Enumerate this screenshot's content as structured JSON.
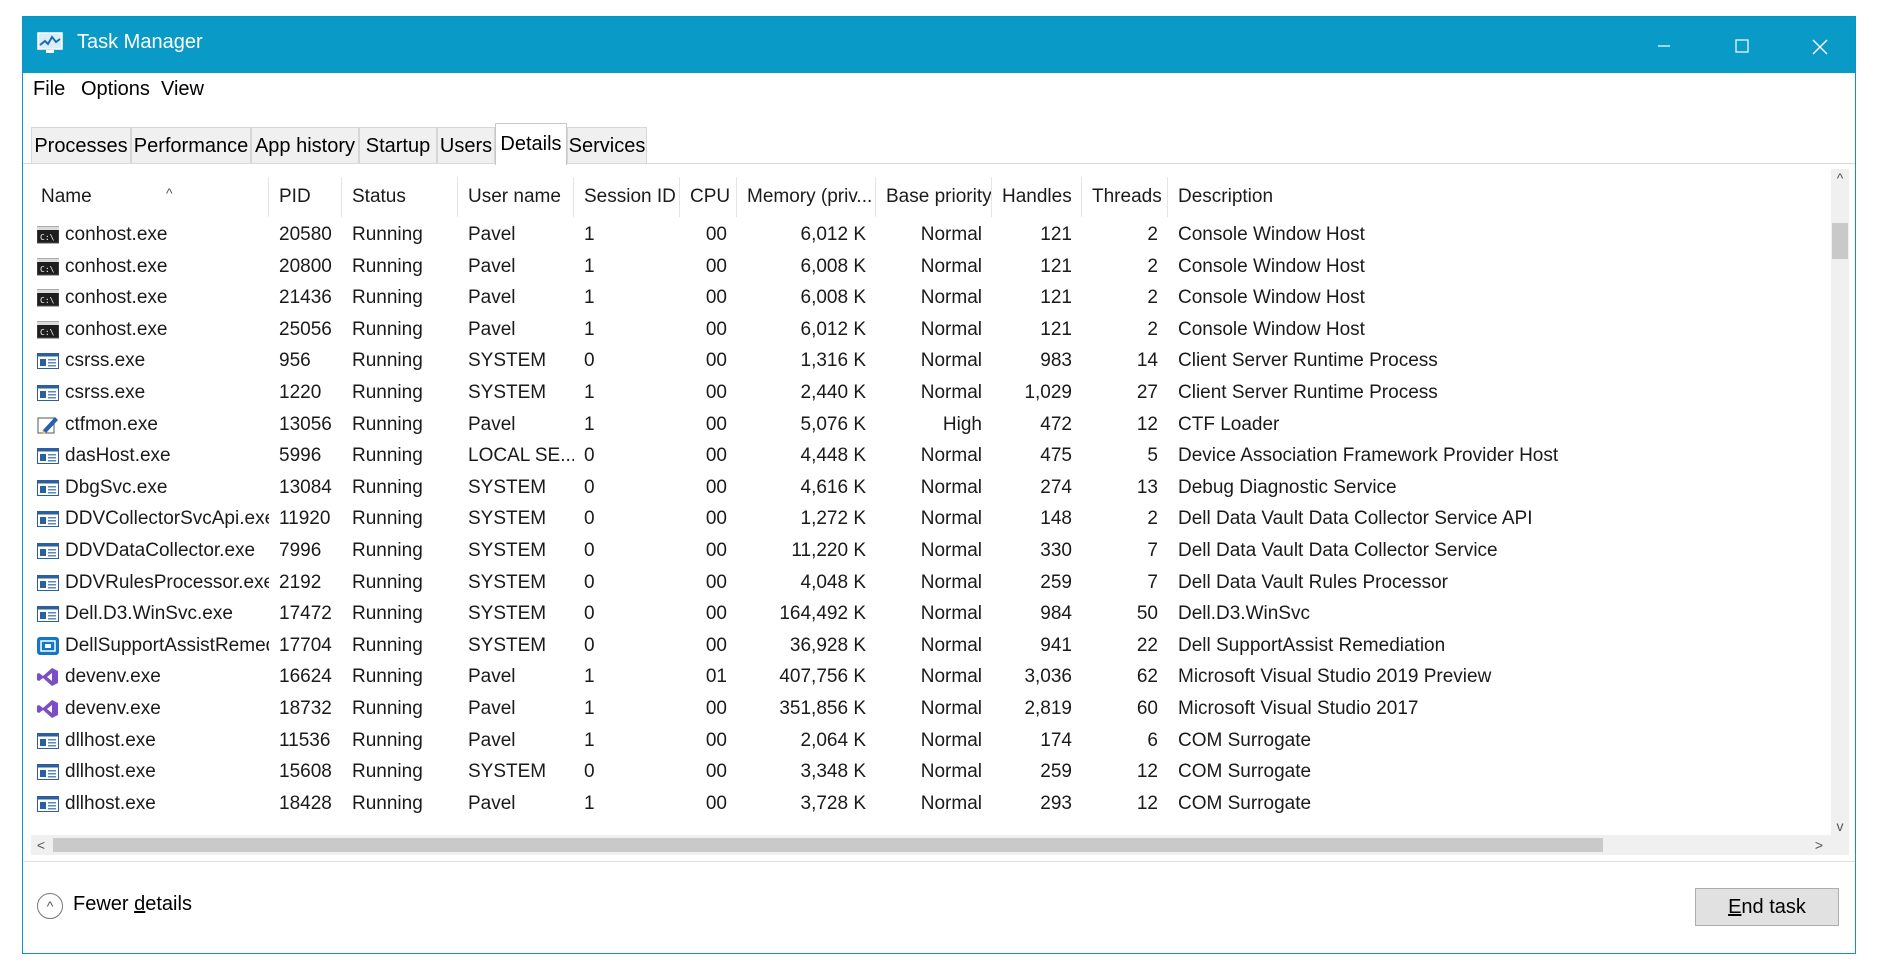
{
  "window": {
    "title": "Task Manager"
  },
  "menu": [
    "File",
    "Options",
    "View"
  ],
  "tabs": [
    "Processes",
    "Performance",
    "App history",
    "Startup",
    "Users",
    "Details",
    "Services"
  ],
  "active_tab": "Details",
  "columns": [
    "Name",
    "PID",
    "Status",
    "User name",
    "Session ID",
    "CPU",
    "Memory (priv...",
    "Base priority",
    "Handles",
    "Threads",
    "Description"
  ],
  "sort_column": "Name",
  "rows": [
    {
      "name": "conhost.exe",
      "icon": "console-icon",
      "pid": "20580",
      "status": "Running",
      "user": "Pavel",
      "session": "1",
      "cpu": "00",
      "memory": "6,012 K",
      "priority": "Normal",
      "handles": "121",
      "threads": "2",
      "description": "Console Window Host"
    },
    {
      "name": "conhost.exe",
      "icon": "console-icon",
      "pid": "20800",
      "status": "Running",
      "user": "Pavel",
      "session": "1",
      "cpu": "00",
      "memory": "6,008 K",
      "priority": "Normal",
      "handles": "121",
      "threads": "2",
      "description": "Console Window Host"
    },
    {
      "name": "conhost.exe",
      "icon": "console-icon",
      "pid": "21436",
      "status": "Running",
      "user": "Pavel",
      "session": "1",
      "cpu": "00",
      "memory": "6,008 K",
      "priority": "Normal",
      "handles": "121",
      "threads": "2",
      "description": "Console Window Host"
    },
    {
      "name": "conhost.exe",
      "icon": "console-icon",
      "pid": "25056",
      "status": "Running",
      "user": "Pavel",
      "session": "1",
      "cpu": "00",
      "memory": "6,012 K",
      "priority": "Normal",
      "handles": "121",
      "threads": "2",
      "description": "Console Window Host"
    },
    {
      "name": "csrss.exe",
      "icon": "app-window-icon",
      "pid": "956",
      "status": "Running",
      "user": "SYSTEM",
      "session": "0",
      "cpu": "00",
      "memory": "1,316 K",
      "priority": "Normal",
      "handles": "983",
      "threads": "14",
      "description": "Client Server Runtime Process"
    },
    {
      "name": "csrss.exe",
      "icon": "app-window-icon",
      "pid": "1220",
      "status": "Running",
      "user": "SYSTEM",
      "session": "1",
      "cpu": "00",
      "memory": "2,440 K",
      "priority": "Normal",
      "handles": "1,029",
      "threads": "27",
      "description": "Client Server Runtime Process"
    },
    {
      "name": "ctfmon.exe",
      "icon": "pen-icon",
      "pid": "13056",
      "status": "Running",
      "user": "Pavel",
      "session": "1",
      "cpu": "00",
      "memory": "5,076 K",
      "priority": "High",
      "handles": "472",
      "threads": "12",
      "description": "CTF Loader"
    },
    {
      "name": "dasHost.exe",
      "icon": "app-window-icon",
      "pid": "5996",
      "status": "Running",
      "user": "LOCAL SE...",
      "session": "0",
      "cpu": "00",
      "memory": "4,448 K",
      "priority": "Normal",
      "handles": "475",
      "threads": "5",
      "description": "Device Association Framework Provider Host"
    },
    {
      "name": "DbgSvc.exe",
      "icon": "app-window-icon",
      "pid": "13084",
      "status": "Running",
      "user": "SYSTEM",
      "session": "0",
      "cpu": "00",
      "memory": "4,616 K",
      "priority": "Normal",
      "handles": "274",
      "threads": "13",
      "description": "Debug Diagnostic Service"
    },
    {
      "name": "DDVCollectorSvcApi.exe",
      "icon": "app-window-icon",
      "pid": "11920",
      "status": "Running",
      "user": "SYSTEM",
      "session": "0",
      "cpu": "00",
      "memory": "1,272 K",
      "priority": "Normal",
      "handles": "148",
      "threads": "2",
      "description": "Dell Data Vault Data Collector Service API"
    },
    {
      "name": "DDVDataCollector.exe",
      "icon": "app-window-icon",
      "pid": "7996",
      "status": "Running",
      "user": "SYSTEM",
      "session": "0",
      "cpu": "00",
      "memory": "11,220 K",
      "priority": "Normal",
      "handles": "330",
      "threads": "7",
      "description": "Dell Data Vault Data Collector Service"
    },
    {
      "name": "DDVRulesProcessor.exe",
      "icon": "app-window-icon",
      "pid": "2192",
      "status": "Running",
      "user": "SYSTEM",
      "session": "0",
      "cpu": "00",
      "memory": "4,048 K",
      "priority": "Normal",
      "handles": "259",
      "threads": "7",
      "description": "Dell Data Vault Rules Processor"
    },
    {
      "name": "Dell.D3.WinSvc.exe",
      "icon": "app-window-icon",
      "pid": "17472",
      "status": "Running",
      "user": "SYSTEM",
      "session": "0",
      "cpu": "00",
      "memory": "164,492 K",
      "priority": "Normal",
      "handles": "984",
      "threads": "50",
      "description": "Dell.D3.WinSvc"
    },
    {
      "name": "DellSupportAssistRemed...",
      "icon": "dell-support-icon",
      "pid": "17704",
      "status": "Running",
      "user": "SYSTEM",
      "session": "0",
      "cpu": "00",
      "memory": "36,928 K",
      "priority": "Normal",
      "handles": "941",
      "threads": "22",
      "description": "Dell SupportAssist Remediation"
    },
    {
      "name": "devenv.exe",
      "icon": "visual-studio-icon",
      "pid": "16624",
      "status": "Running",
      "user": "Pavel",
      "session": "1",
      "cpu": "01",
      "memory": "407,756 K",
      "priority": "Normal",
      "handles": "3,036",
      "threads": "62",
      "description": "Microsoft Visual Studio 2019 Preview"
    },
    {
      "name": "devenv.exe",
      "icon": "visual-studio-icon",
      "pid": "18732",
      "status": "Running",
      "user": "Pavel",
      "session": "1",
      "cpu": "00",
      "memory": "351,856 K",
      "priority": "Normal",
      "handles": "2,819",
      "threads": "60",
      "description": "Microsoft Visual Studio 2017"
    },
    {
      "name": "dllhost.exe",
      "icon": "app-window-icon",
      "pid": "11536",
      "status": "Running",
      "user": "Pavel",
      "session": "1",
      "cpu": "00",
      "memory": "2,064 K",
      "priority": "Normal",
      "handles": "174",
      "threads": "6",
      "description": "COM Surrogate"
    },
    {
      "name": "dllhost.exe",
      "icon": "app-window-icon",
      "pid": "15608",
      "status": "Running",
      "user": "SYSTEM",
      "session": "0",
      "cpu": "00",
      "memory": "3,348 K",
      "priority": "Normal",
      "handles": "259",
      "threads": "12",
      "description": "COM Surrogate"
    },
    {
      "name": "dllhost.exe",
      "icon": "app-window-icon",
      "pid": "18428",
      "status": "Running",
      "user": "Pavel",
      "session": "1",
      "cpu": "00",
      "memory": "3,728 K",
      "priority": "Normal",
      "handles": "293",
      "threads": "12",
      "description": "COM Surrogate"
    }
  ],
  "footer": {
    "fewer_details_label": "Fewer details",
    "end_task_label": "End task"
  },
  "colors": {
    "titlebar": "#0a9ac7",
    "window_border": "#0a93c8",
    "button_bg": "#e1e1e1"
  }
}
